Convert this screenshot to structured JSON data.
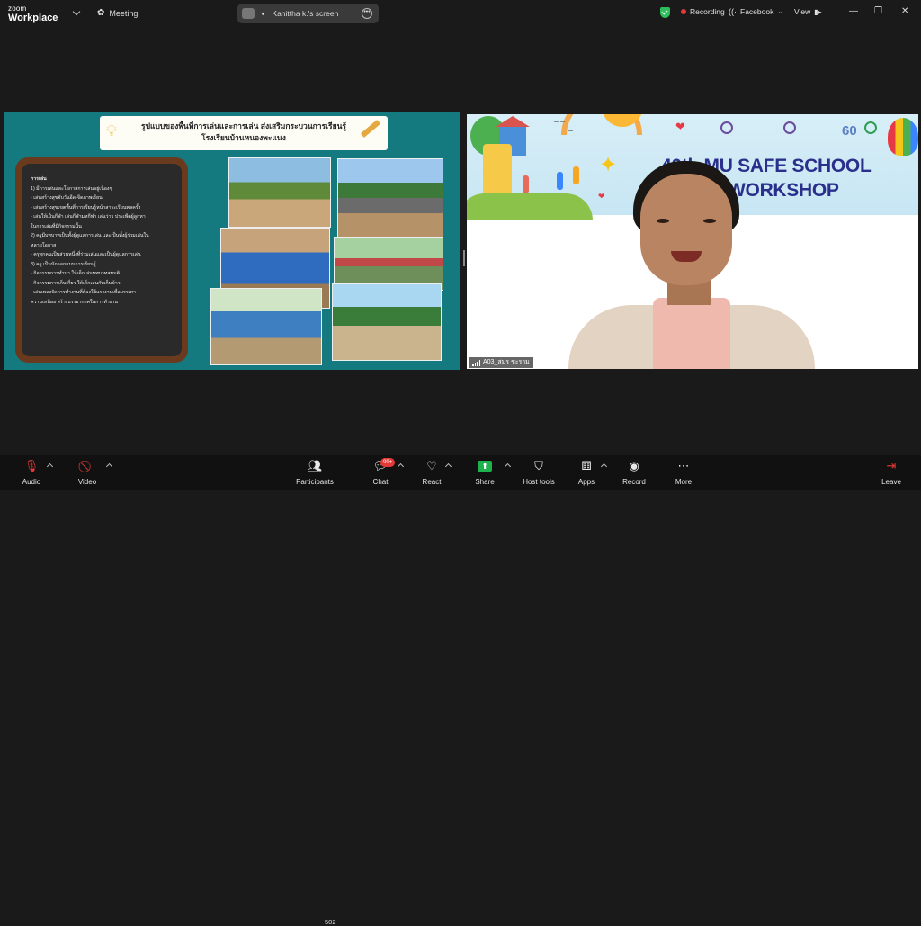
{
  "app": {
    "brand_line1": "zoom",
    "brand_line2": "Workplace"
  },
  "topbar": {
    "meeting_label": "Meeting",
    "screen_share_label": "Kanittha k.'s screen",
    "recording_label": "Recording",
    "facebook_label": "Facebook",
    "view_label": "View"
  },
  "slide": {
    "title_line1": "รูปแบบของพื้นที่การเล่นและการเล่น ส่งเสริมกระบวนการเรียนรู้",
    "title_line2": "โรงเรียนบ้านหนองพะแนง",
    "board_lines": [
      "การเล่น",
      "1) มีการเล่นและโอกาสการเล่นอยู่เนืองๆ",
      "  - เล่นสร้างสุขจับวันอีด-จีดภาพเรียน",
      "  - เล่นสร้างสุขเขตพื้นที่การเรียนรู้หน้าสาระเรียนพลครั้ง",
      "  - เล่นให้เป็นกีฬา เล่นกีฬามหกีฬา เล่นว่าว ประเพีตผู้ลูกหา",
      "  ในการเล่นที่มีกิจกรรมนั้น",
      "2) ครูมีบทบาทเป็นทั้งผู้ดูแลการเล่น และเป็นทั้งผู้ร่วมเล่นใน",
      "  หลายโอกาส",
      "  - ครูทุกคนเป็นส่วนหนึ่งที่ร่วมเล่นและเป็นผู้ดูแลการเล่น",
      "3) ครู เป็นนักออกแบบการเรียนรู้",
      "  - กิจกรรมการทำนา ให้เด็กเล่นบทบาทสมมติ",
      "  - กิจกรรมการเก็บเกี่ยว ให้เด็กเล่นกับเก็บข้าว",
      "  - เล่นเพลงจัดการทำงานที่ต้องใช้แรงงานเพื่อบรรเทา",
      "  ความเหนื่อย สร้างบรรยากาศในการทำงาน"
    ]
  },
  "video": {
    "banner_title_line1": "40th MU SAFE SCHOOL",
    "banner_title_line2": "ANNUAL WORKSHOP",
    "participant_name": "A03_สมร ชะราม"
  },
  "toolbar": {
    "audio": "Audio",
    "video": "Video",
    "participants": "Participants",
    "participants_count": "502",
    "chat": "Chat",
    "chat_badge": "99+",
    "react": "React",
    "share": "Share",
    "host_tools": "Host tools",
    "apps": "Apps",
    "record": "Record",
    "more": "More",
    "leave": "Leave"
  },
  "colors": {
    "slide_bg": "#147a80",
    "share_green": "#1fb14d",
    "recording_red": "#e53935",
    "toolbar_bg": "#111111"
  }
}
